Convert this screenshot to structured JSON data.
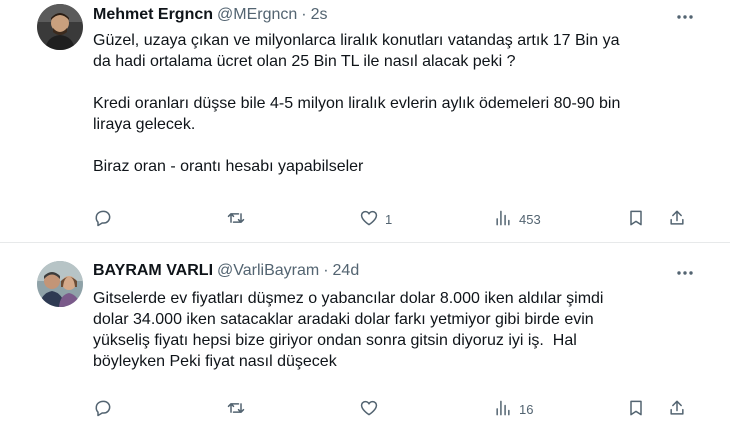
{
  "tweets": [
    {
      "author_name": "Mehmet Ergncn",
      "handle": "@MErgncn",
      "separator": "·",
      "time": "2s",
      "paragraphs": [
        "Güzel, uzaya çıkan ve milyonlarca liralık konutları vatandaş artık 17 Bin ya\nda hadi ortalama ücret olan 25 Bin TL ile nasıl alacak peki ?",
        "Kredi oranları düşse bile 4-5 milyon liralık evlerin aylık ödemeleri 80-90 bin\nliraya gelecek.",
        "Biraz oran - orantı hesabı yapabilseler"
      ],
      "actions": {
        "reply": "",
        "retweet": "",
        "like": "1",
        "views": "453"
      }
    },
    {
      "author_name": "BAYRAM VARLI",
      "handle": "@VarliBayram",
      "separator": "·",
      "time": "24d",
      "paragraphs": [
        "Gitselerde ev fiyatları düşmez o yabancılar dolar 8.000 iken aldılar şimdi\ndolar 34.000 iken satacaklar aradaki dolar farkı yetmiyor gibi birde evin\nyükseliş fiyatı hepsi bize giriyor ondan sonra gitsin diyoruz iyi iş.  Hal\nböyleyken Peki fiyat nasıl düşecek"
      ],
      "actions": {
        "reply": "",
        "retweet": "",
        "like": "",
        "views": "16"
      }
    }
  ],
  "colors": {
    "text": "#0f1419",
    "muted": "#536471",
    "divider": "#e7e9ea"
  },
  "icons": [
    "more-icon",
    "reply-icon",
    "retweet-icon",
    "like-icon",
    "views-icon",
    "bookmark-icon",
    "share-icon"
  ]
}
